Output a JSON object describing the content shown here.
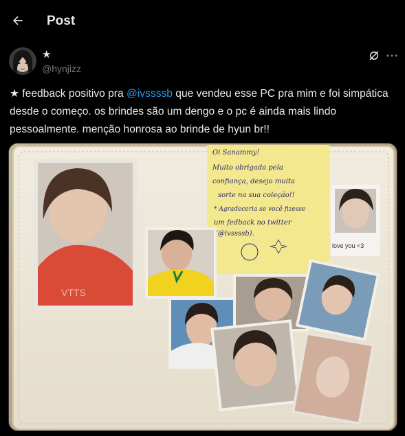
{
  "header": {
    "title": "Post"
  },
  "author": {
    "display_name": "★",
    "handle": "@hynjizz"
  },
  "post": {
    "text_part1": "★ feedback positivo pra ",
    "mention": "@ivssssb",
    "text_part2": " que vendeu esse PC pra mim e foi simpática desde o começo. os brindes são um dengo e o pc é ainda mais lindo pessoalmente. menção honrosa ao brinde de hyun br!!"
  },
  "media": {
    "photocard_text": "VTTS",
    "note_lines": [
      "Oi Sanammy!",
      "Muito obrigada pela",
      "confiança, desejo muita",
      "sorte na sua coleção!!",
      "* Agradeceria se você fizesse",
      "um fedback no twitter",
      "(@ivssssb)."
    ],
    "polaroid_caption": "love you <3"
  },
  "colors": {
    "background": "#000000",
    "text": "#e7e9ea",
    "muted": "#71767b",
    "link": "#1d9bf0"
  },
  "icons": {
    "back": "arrow-left-icon",
    "grok": "grok-icon",
    "more": "more-horizontal-icon"
  }
}
